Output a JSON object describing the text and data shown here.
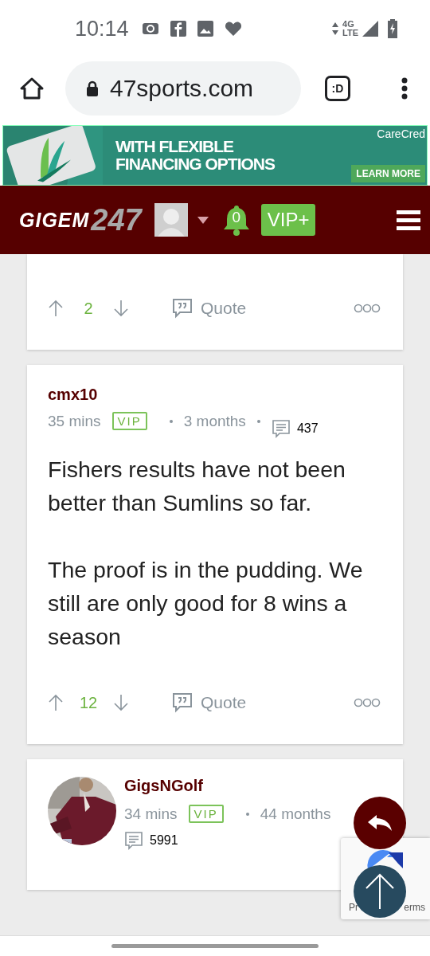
{
  "status_bar": {
    "time": "10:14",
    "network": "4G",
    "network_type": "LTE"
  },
  "browser": {
    "url": "47sports.com",
    "tab_switcher": ":D"
  },
  "ad": {
    "headline": [
      "WITH FLEXIBLE",
      "FINANCING OPTIONS"
    ],
    "brand": "CareCred",
    "button": "LEARN MORE"
  },
  "header": {
    "logo_word": "GIGEM",
    "logo_number": "247",
    "notification_count": "0",
    "vip_button": "VIP+"
  },
  "posts": [
    {
      "kind": "actions",
      "votes": "2",
      "quote": "Quote"
    },
    {
      "kind": "full",
      "author": "cmx10",
      "time": "35 mins",
      "badge": "VIP",
      "tenure": "3 months",
      "post_count": "437",
      "body": [
        "Fishers results have not been better than Sumlins so far.",
        "The proof is in the pudding. We still are only good for 8 wins a season"
      ],
      "votes": "12",
      "quote": "Quote"
    },
    {
      "kind": "avatar",
      "author": "GigsNGolf",
      "time": "34 mins",
      "badge": "VIP",
      "tenure": "44 months",
      "post_count": "5991"
    }
  ],
  "recaptcha": {
    "left_text": "Pr",
    "right_text": "erms"
  }
}
